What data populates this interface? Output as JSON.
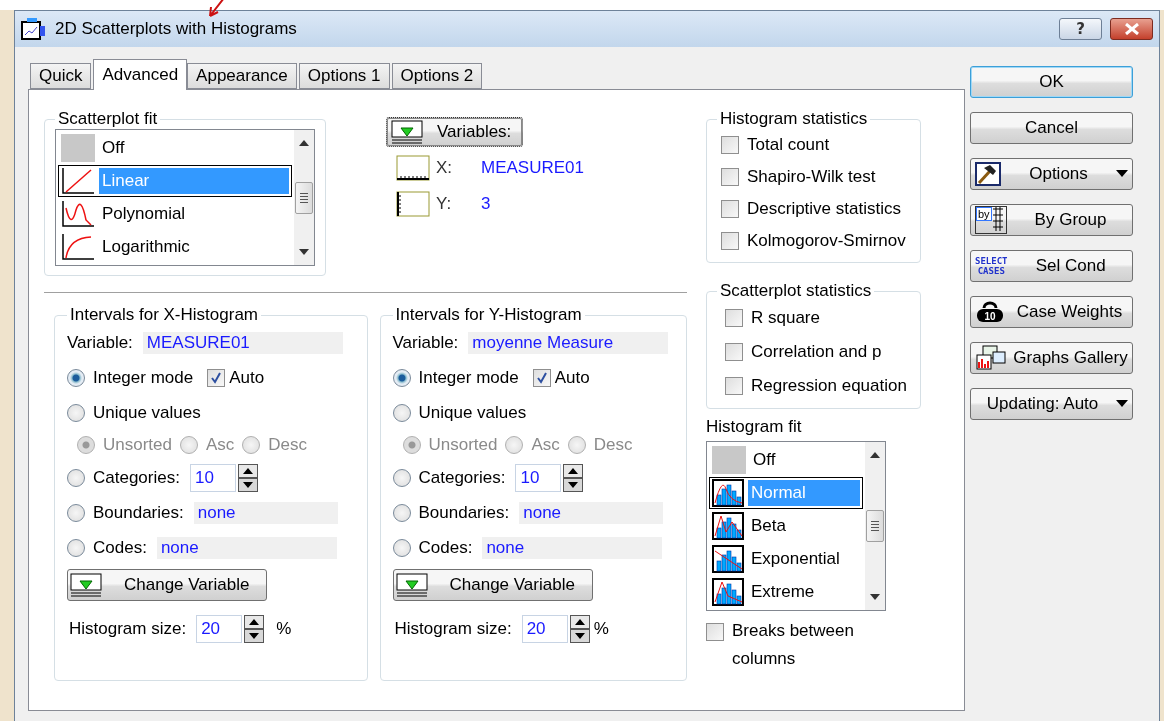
{
  "window": {
    "title": "2D Scatterplots with Histograms",
    "help": "?"
  },
  "tabs": [
    {
      "label": "Quick",
      "selected": false
    },
    {
      "label": "Advanced",
      "selected": true
    },
    {
      "label": "Appearance",
      "selected": false
    },
    {
      "label": "Options 1",
      "selected": false
    },
    {
      "label": "Options 2",
      "selected": false
    }
  ],
  "scatterplot_fit": {
    "label": "Scatterplot fit",
    "items": [
      {
        "kind": "off",
        "label": "Off",
        "selected": false
      },
      {
        "kind": "linear",
        "label": "Linear",
        "selected": true
      },
      {
        "kind": "polynomial",
        "label": "Polynomial",
        "selected": false
      },
      {
        "kind": "logarithmic",
        "label": "Logarithmic",
        "selected": false
      }
    ]
  },
  "variables": {
    "button": "Variables:",
    "x": {
      "label": "X:",
      "value": "MEASURE01"
    },
    "y": {
      "label": "Y:",
      "value": "3"
    }
  },
  "histogram_statistics": {
    "label": "Histogram statistics",
    "items": [
      {
        "label": "Total count",
        "checked": false
      },
      {
        "label": "Shapiro-Wilk test",
        "checked": false
      },
      {
        "label": "Descriptive statistics",
        "checked": false
      },
      {
        "label": "Kolmogorov-Smirnov",
        "checked": false
      }
    ]
  },
  "scatterplot_statistics": {
    "label": "Scatterplot statistics",
    "items": [
      {
        "label": "R square",
        "checked": false
      },
      {
        "label": "Correlation and p",
        "checked": false
      },
      {
        "label": "Regression equation",
        "checked": false
      }
    ]
  },
  "histograms": [
    {
      "title": "Intervals for X-Histogram",
      "variable_label": "Variable:",
      "variable": "MEASURE01",
      "integer_mode": {
        "label": "Integer mode",
        "selected": true
      },
      "auto": {
        "label": "Auto",
        "checked": true
      },
      "unique_values": {
        "label": "Unique values",
        "selected": false
      },
      "sort": [
        {
          "label": "Unsorted",
          "selected": true,
          "disabled": true
        },
        {
          "label": "Asc",
          "selected": false,
          "disabled": true
        },
        {
          "label": "Desc",
          "selected": false,
          "disabled": true
        }
      ],
      "categories": {
        "label": "Categories:",
        "value": "10",
        "selected": false
      },
      "boundaries": {
        "label": "Boundaries:",
        "value": "none",
        "selected": false
      },
      "codes": {
        "label": "Codes:",
        "value": "none",
        "selected": false
      },
      "change_button": "Change Variable",
      "size_label": "Histogram size:",
      "size": "20",
      "unit": "%"
    },
    {
      "title": "Intervals for Y-Histogram",
      "variable_label": "Variable:",
      "variable": "moyenne Measure",
      "integer_mode": {
        "label": "Integer mode",
        "selected": true
      },
      "auto": {
        "label": "Auto",
        "checked": true
      },
      "unique_values": {
        "label": "Unique values",
        "selected": false
      },
      "sort": [
        {
          "label": "Unsorted",
          "selected": true,
          "disabled": true
        },
        {
          "label": "Asc",
          "selected": false,
          "disabled": true
        },
        {
          "label": "Desc",
          "selected": false,
          "disabled": true
        }
      ],
      "categories": {
        "label": "Categories:",
        "value": "10",
        "selected": false
      },
      "boundaries": {
        "label": "Boundaries:",
        "value": "none",
        "selected": false
      },
      "codes": {
        "label": "Codes:",
        "value": "none",
        "selected": false
      },
      "change_button": "Change Variable",
      "size_label": "Histogram size:",
      "size": "20",
      "unit": "%"
    }
  ],
  "histogram_fit": {
    "label": "Histogram fit",
    "items": [
      {
        "kind": "off",
        "label": "Off",
        "selected": false
      },
      {
        "kind": "normal",
        "label": "Normal",
        "selected": true
      },
      {
        "kind": "beta",
        "label": "Beta",
        "selected": false
      },
      {
        "kind": "exponential",
        "label": "Exponential",
        "selected": false
      },
      {
        "kind": "extreme",
        "label": "Extreme",
        "selected": false
      }
    ]
  },
  "breaks": {
    "label": "Breaks between columns",
    "checked": false
  },
  "buttons": [
    {
      "kind": "default",
      "label": "OK"
    },
    {
      "kind": "plain",
      "label": "Cancel"
    },
    {
      "kind": "options",
      "label": "Options",
      "dropdown": true
    },
    {
      "kind": "by-group",
      "label": "By Group",
      "icon_text": "by"
    },
    {
      "kind": "select-cases",
      "label": "Sel Cond",
      "icon_text": [
        "SELECT",
        "CASES"
      ]
    },
    {
      "kind": "weights",
      "label": "Case Weights",
      "icon_text": "10"
    },
    {
      "kind": "gallery",
      "label": "Graphs Gallery"
    },
    {
      "kind": "plain",
      "label": "Updating: Auto",
      "dropdown": true
    }
  ]
}
